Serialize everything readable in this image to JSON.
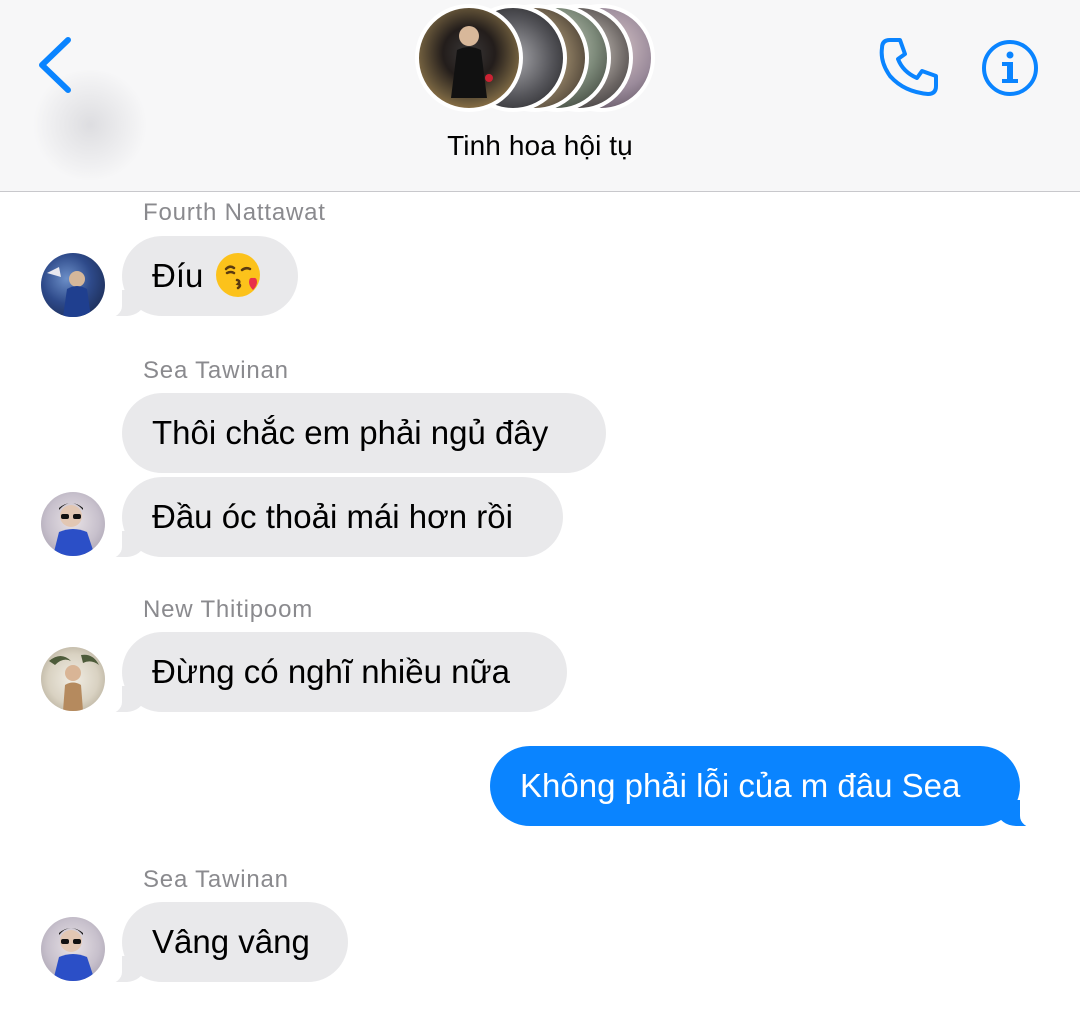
{
  "header": {
    "title": "Tinh hoa hội tụ",
    "back_icon": "chevron-left-icon",
    "call_icon": "phone-icon",
    "info_icon": "info-icon",
    "accent_color": "#0a84ff"
  },
  "messages": [
    {
      "sender": "Fourth Nattawat",
      "bubbles": [
        {
          "text": "Đíu",
          "emoji": "kissing-face-with-heart-icon"
        }
      ]
    },
    {
      "sender": "Sea Tawinan",
      "bubbles": [
        {
          "text": "Thôi chắc em phải ngủ đây"
        },
        {
          "text": "Đầu óc thoải mái hơn rồi"
        }
      ]
    },
    {
      "sender": "New Thitipoom",
      "bubbles": [
        {
          "text": "Đừng có nghĩ nhiều nữa"
        }
      ]
    },
    {
      "sender": "",
      "outgoing": true,
      "bubbles": [
        {
          "text": "Không phải lỗi của m đâu Sea"
        }
      ]
    },
    {
      "sender": "Sea Tawinan",
      "bubbles": [
        {
          "text": "Vâng vâng"
        }
      ]
    }
  ],
  "colors": {
    "incoming_bubble": "#e9e9eb",
    "outgoing_bubble": "#0a84ff",
    "sender_name": "#8a8a8e"
  }
}
